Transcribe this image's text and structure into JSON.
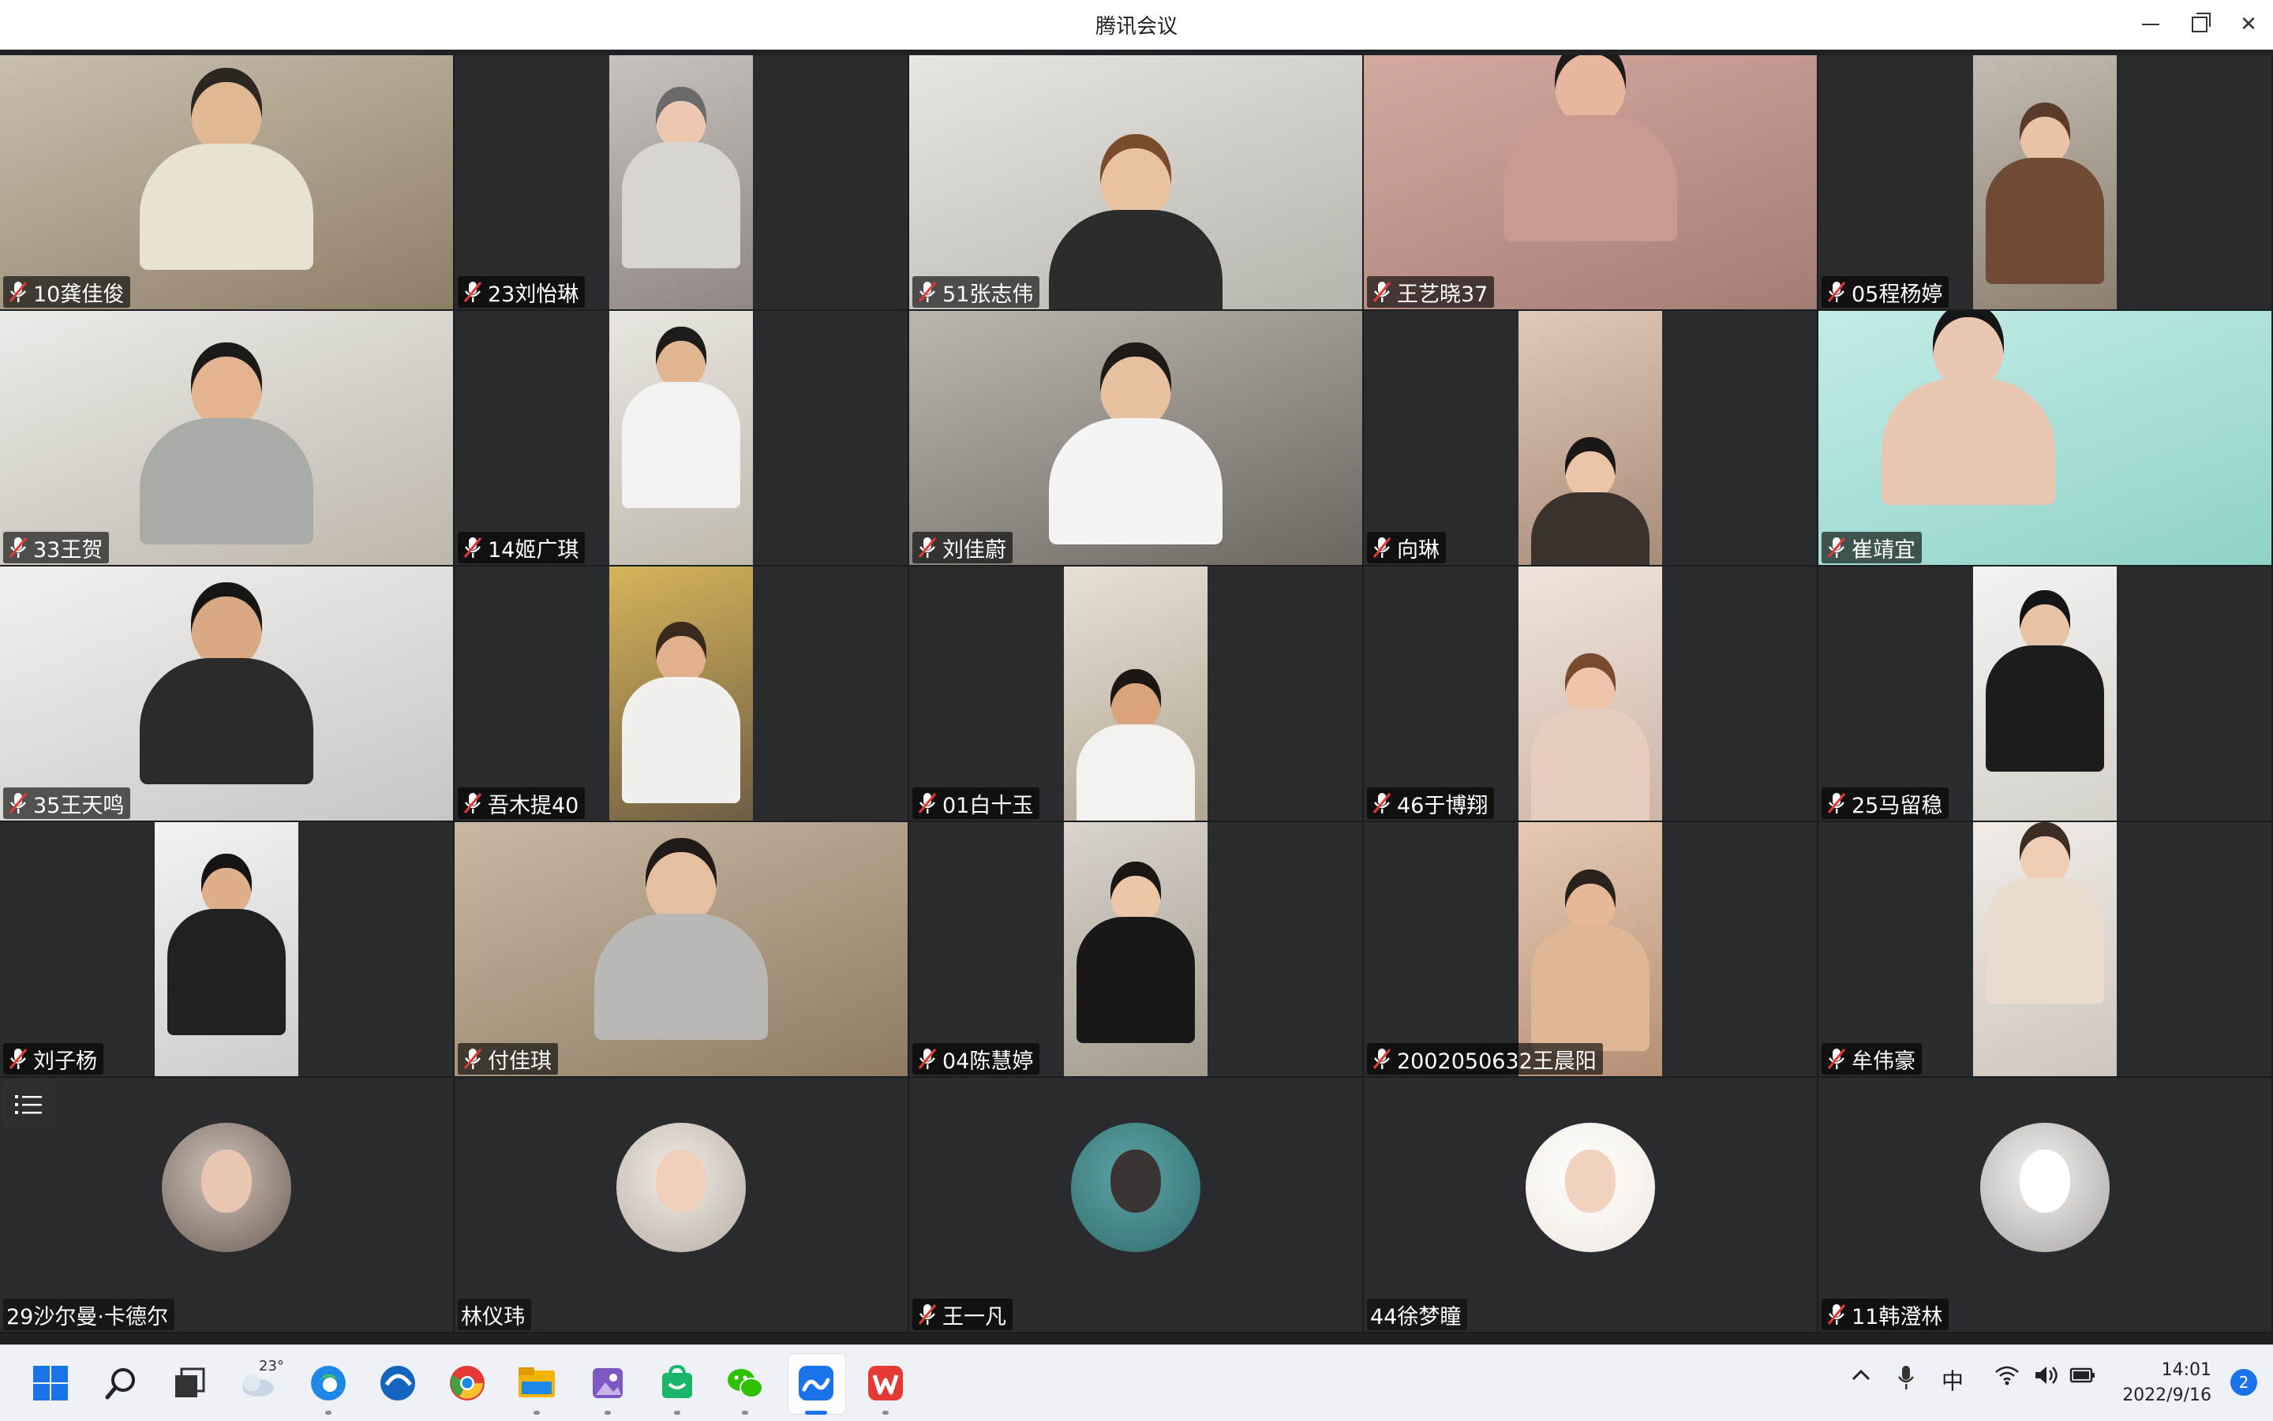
{
  "window": {
    "title": "腾讯会议"
  },
  "participants": [
    {
      "name": "10龚佳俊",
      "muted": true
    },
    {
      "name": "23刘怡琳",
      "muted": true
    },
    {
      "name": "51张志伟",
      "muted": true
    },
    {
      "name": "王艺晓37",
      "muted": true
    },
    {
      "name": "05程杨婷",
      "muted": true
    },
    {
      "name": "33王贺",
      "muted": true
    },
    {
      "name": "14姬广琪",
      "muted": true
    },
    {
      "name": "刘佳蔚",
      "muted": true
    },
    {
      "name": "向琳",
      "muted": true
    },
    {
      "name": "崔靖宜",
      "muted": true
    },
    {
      "name": "35王天鸣",
      "muted": true
    },
    {
      "name": "吾木提40",
      "muted": true
    },
    {
      "name": "01白十玉",
      "muted": true
    },
    {
      "name": "46于博翔",
      "muted": true
    },
    {
      "name": "25马留稳",
      "muted": true
    },
    {
      "name": "刘子杨",
      "muted": true
    },
    {
      "name": "付佳琪",
      "muted": true
    },
    {
      "name": "04陈慧婷",
      "muted": true
    },
    {
      "name": "2002050632王晨阳",
      "muted": true
    },
    {
      "name": "牟伟豪",
      "muted": true
    },
    {
      "name": "29沙尔曼·卡德尔",
      "muted": false
    },
    {
      "name": "林仪玮",
      "muted": false
    },
    {
      "name": "王一凡",
      "muted": true
    },
    {
      "name": "44徐梦瞳",
      "muted": false
    },
    {
      "name": "11韩澄林",
      "muted": true
    }
  ],
  "taskbar": {
    "weather_temp": "23°",
    "ime_indicator": "中",
    "time": "14:01",
    "date": "2022/9/16",
    "notification_count": "2",
    "apps": [
      "start-icon",
      "search-icon",
      "task-view-icon",
      "weather-icon",
      "edge-icon",
      "edge-alt-icon",
      "chrome-icon",
      "file-explorer-icon",
      "photos-icon",
      "store-icon",
      "wechat-icon",
      "tencent-meeting-icon",
      "wps-icon"
    ]
  },
  "colors": {
    "accent": "#1a73e8",
    "muted_mic": "#e53935",
    "tile_bg": "#2a2b2e"
  }
}
